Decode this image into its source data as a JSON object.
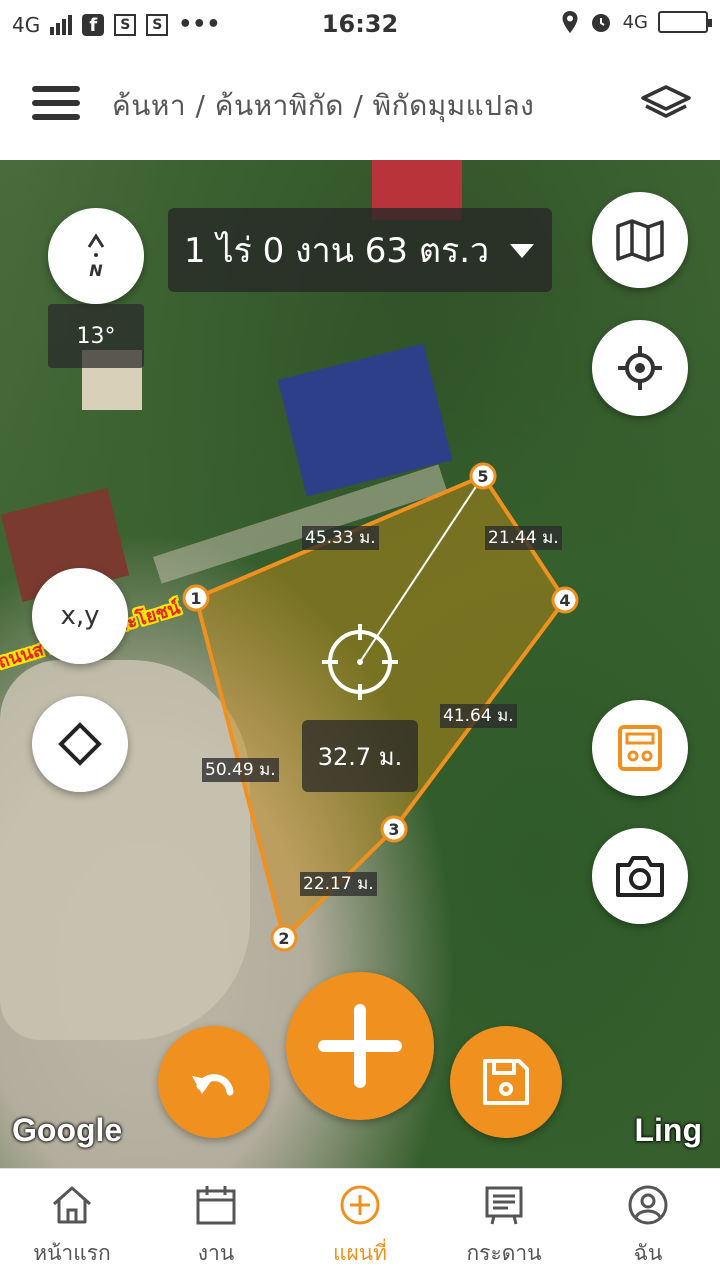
{
  "status_bar": {
    "network": "4G",
    "time": "16:32",
    "network_right": "4G",
    "icons": [
      "signal-icon",
      "facebook-icon",
      "s-app-icon",
      "s-app-icon",
      "more-icon",
      "location-icon",
      "alarm-icon",
      "battery-icon"
    ]
  },
  "header": {
    "breadcrumb": "ค้นหา / ค้นหาพิกัด / พิกัดมุมแปลง",
    "menu_icon": "hamburger-icon",
    "layers_icon": "layers-icon"
  },
  "map": {
    "area_text": "1 ไร่ 0 งาน 63 ตร.ว",
    "bearing": "13°",
    "compass_label": "N",
    "xy_label": "x,y",
    "distance": "32.7 ม.",
    "road_label": "ถนนสาธารณะประโยชน์",
    "watermark_left": "Google",
    "watermark_right": "Ling",
    "vertices": [
      "1",
      "2",
      "3",
      "4",
      "5"
    ],
    "segments": {
      "s1_5": "45.33 ม.",
      "s5_4": "21.44 ม.",
      "s4_3": "41.64 ม.",
      "s1_2": "50.49 ม.",
      "s2_3": "22.17 ม."
    },
    "accent": "#f0911f"
  },
  "bottom_nav": [
    {
      "label": "หน้าแรก",
      "icon": "home-icon"
    },
    {
      "label": "งาน",
      "icon": "calendar-icon"
    },
    {
      "label": "แผนที่",
      "icon": "plus-circle-icon",
      "active": true
    },
    {
      "label": "กระดาน",
      "icon": "board-icon"
    },
    {
      "label": "ฉัน",
      "icon": "profile-icon"
    }
  ]
}
